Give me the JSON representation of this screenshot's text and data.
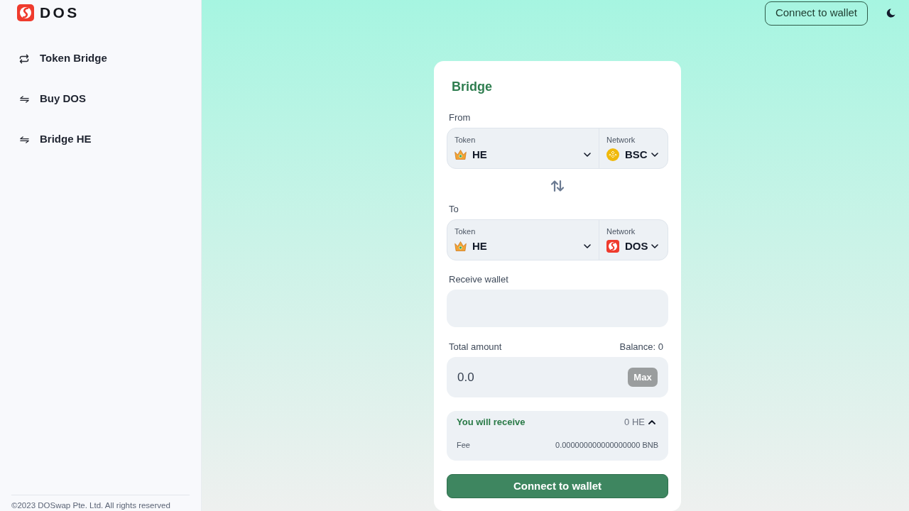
{
  "sidebar": {
    "logo": "DOS",
    "nav_items": [
      {
        "label": "Token Bridge",
        "kind": "cycle"
      },
      {
        "label": "Buy DOS",
        "kind": "swap"
      },
      {
        "label": "Bridge HE",
        "kind": "swap"
      }
    ],
    "footer": "©2023 DOSwap Pte. Ltd. All rights reserved"
  },
  "header": {
    "connect_button": "Connect to wallet"
  },
  "bridge": {
    "title": "Bridge",
    "routes": [
      {
        "label": "From",
        "token": {
          "label": "Token",
          "name": "HE"
        },
        "network": {
          "label": "Network",
          "name": "BSC",
          "kind": "coin"
        }
      },
      {
        "label": "To",
        "token": {
          "label": "Token",
          "name": "HE"
        },
        "network": {
          "label": "Network",
          "name": "DOS",
          "kind": "logo"
        }
      }
    ],
    "receive_wallet": {
      "label": "Receive wallet"
    },
    "amount": {
      "label": "Total amount",
      "balance": "Balance: 0",
      "value": "0.0",
      "max_button": "Max"
    },
    "receive": {
      "label": "You will receive",
      "amount": "0 HE",
      "expanded": true,
      "fee_label": "Fee",
      "fee": "0.000000000000000000 BNB"
    },
    "submit_button": "Connect to wallet"
  }
}
